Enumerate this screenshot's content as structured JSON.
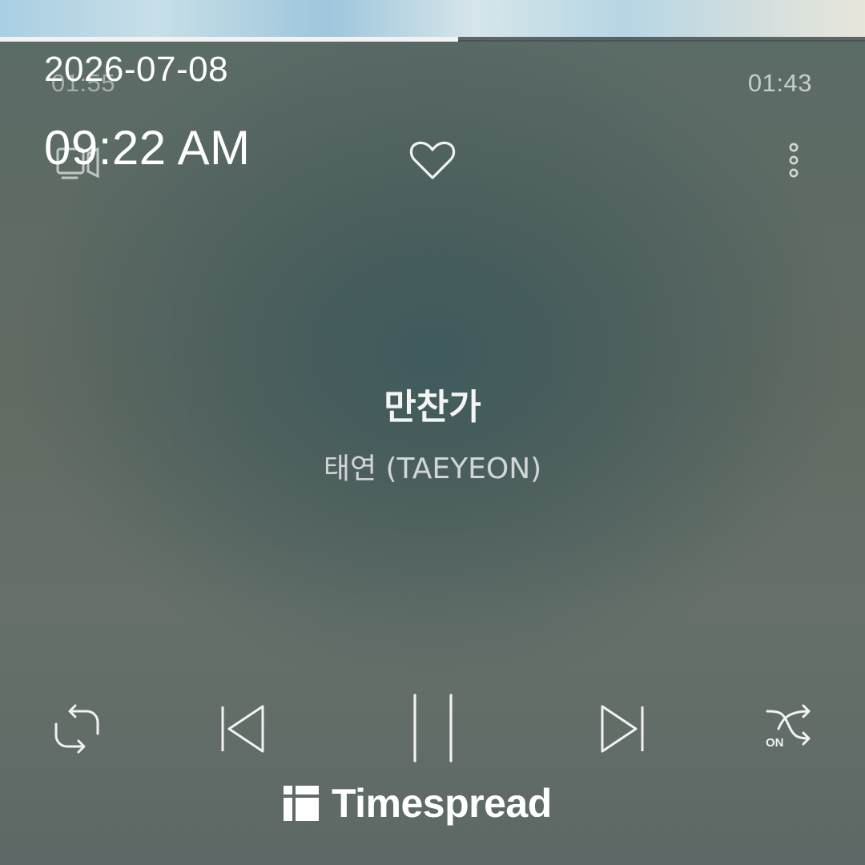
{
  "player": {
    "progress": 0.53,
    "elapsed": "01:55",
    "duration": "01:43",
    "track_title": "만찬가",
    "artist": "태연 (TAEYEON)",
    "shuffle_state": "ON"
  },
  "overlay": {
    "date": "2026-07-08",
    "time": "09:22 AM"
  },
  "icons": {
    "lyrics": "lyrics-icon",
    "like": "heart-icon",
    "more": "more-vertical-icon",
    "repeat": "repeat-icon",
    "previous": "previous-icon",
    "play_pause": "pause-icon",
    "next": "next-icon",
    "shuffle": "shuffle-icon"
  },
  "watermark": {
    "brand": "Timespread"
  },
  "colors": {
    "icon": "#f2f2f2",
    "progress_fill": "#f2f2f2"
  }
}
